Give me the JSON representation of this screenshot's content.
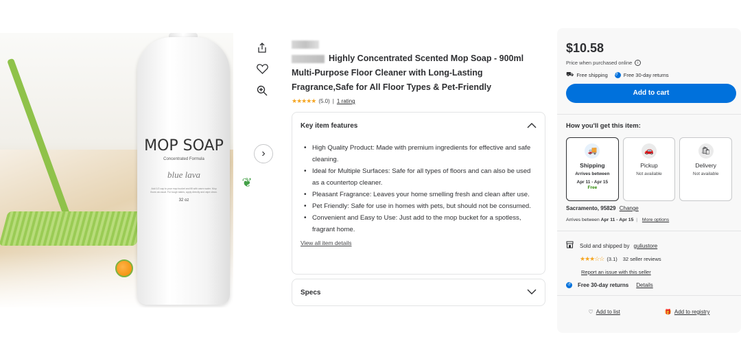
{
  "product": {
    "title": "Highly Concentrated Scented Mop Soap - 900ml Multi-Purpose Floor Cleaner with Long-Lasting Fragrance,Safe for All Floor Types & Pet-Friendly",
    "rating_stars": "★★★★★",
    "rating_value": "(5.0)",
    "rating_sep": "|",
    "rating_count": "1 rating",
    "image_label": {
      "title": "MOP SOAP",
      "subtitle": "Concentrated Formula",
      "brand": "blue lava",
      "fine_print": "Add 1/2 cap to your mop bucket and fill with warm water. Mop floors as usual. For tough stains, apply directly and wipe clean.",
      "size": "32 oz"
    }
  },
  "side_actions": {
    "share_icon": "share-icon",
    "favorite_icon": "heart-icon",
    "zoom_icon": "zoom-in-icon",
    "next_icon": "chevron-right-icon"
  },
  "features": {
    "heading": "Key item features",
    "items": [
      "High Quality Product: Made with premium ingredients for effective and safe cleaning.",
      "Ideal for Multiple Surfaces: Safe for all types of floors and can also be used as a countertop cleaner.",
      "Pleasant Fragrance: Leaves your home smelling fresh and clean after use.",
      "Pet Friendly: Safe for use in homes with pets, but should not be consumed.",
      "Convenient and Easy to Use: Just add to the mop bucket for a spotless, fragrant home."
    ],
    "view_all": "View all item details"
  },
  "specs": {
    "heading": "Specs"
  },
  "buy_box": {
    "price": "$10.58",
    "price_note": "Price when purchased online",
    "free_shipping": "Free shipping",
    "free_returns_short": "Free 30-day returns",
    "add_to_cart": "Add to cart",
    "get_item_title": "How you'll get this item:",
    "options": [
      {
        "name": "Shipping",
        "line1": "Arrives between",
        "line2": "Apr 11 - Apr 15",
        "line3": "Free"
      },
      {
        "name": "Pickup",
        "line1": "Not available"
      },
      {
        "name": "Delivery",
        "line1": "Not available"
      }
    ],
    "location": "Sacramento, 95829",
    "change": "Change",
    "arrives_prefix": "Arrives between",
    "arrives_dates": "Apr 11 - Apr 15",
    "more_options": "More options",
    "sold_by_prefix": "Sold and shipped by",
    "seller": "guliustore",
    "seller_stars": "★★★☆☆",
    "seller_rating": "(3.1)",
    "seller_reviews": "32 seller reviews",
    "report": "Report an issue with this seller",
    "returns_bold": "Free 30-day returns",
    "returns_details": "Details",
    "add_to_list": "Add to list",
    "add_to_registry": "Add to registry"
  },
  "colors": {
    "accent": "#0071dc",
    "star": "#f5a623",
    "free": "#2a8703"
  }
}
